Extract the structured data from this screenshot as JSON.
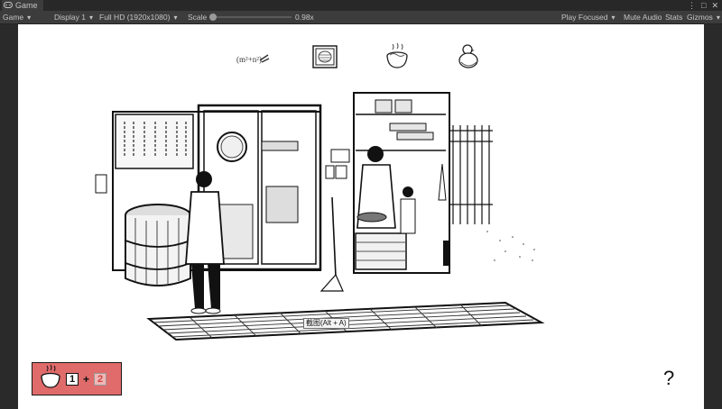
{
  "window": {
    "tab_label": "Game",
    "controls": [
      "⋮",
      "□",
      "✕"
    ]
  },
  "toolbar": {
    "view": "Game",
    "display": "Display 1",
    "resolution": "Full HD (1920x1080)",
    "scale_label": "Scale",
    "scale_value": "0.98x",
    "play_mode": "Play Focused",
    "mute": "Mute Audio",
    "stats": "Stats",
    "gizmos": "Gizmos"
  },
  "game": {
    "top_icons": [
      "formula-icon",
      "plate-icon",
      "noodle-bowl-icon",
      "chick-icon"
    ],
    "tooltip": "截图(Alt + A)",
    "recipe": {
      "first": "1",
      "plus": "+",
      "second": "2",
      "bg_color": "#e06b6b"
    },
    "help": "?"
  }
}
